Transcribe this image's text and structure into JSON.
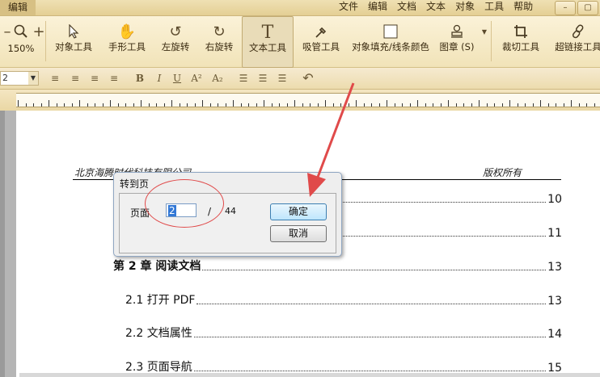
{
  "app_tab": "编辑",
  "menu": [
    "文件",
    "编辑",
    "文档",
    "文本",
    "对象",
    "工具",
    "帮助"
  ],
  "window": {
    "minimize": "–",
    "restore": "▢"
  },
  "toolbar": {
    "zoom_in": "+",
    "zoom_level": "150%",
    "tools": [
      {
        "label": "对象工具",
        "icon": "cursor-icon"
      },
      {
        "label": "手形工具",
        "icon": "hand-icon"
      },
      {
        "label": "左旋转",
        "icon": "rotate-left-icon"
      },
      {
        "label": "右旋转",
        "icon": "rotate-right-icon"
      },
      {
        "label": "文本工具",
        "icon": "text-tool-icon"
      },
      {
        "label": "吸管工具",
        "icon": "eyedropper-icon"
      },
      {
        "label": "对象填充/线条颜色",
        "icon": "fill-color-icon"
      },
      {
        "label": "图章 (S)",
        "icon": "stamp-icon"
      },
      {
        "label": "裁切工具",
        "icon": "crop-icon"
      },
      {
        "label": "超链接工具",
        "icon": "link-icon"
      }
    ]
  },
  "format": {
    "font_size": "2",
    "bold": "B",
    "italic": "I",
    "underline": "U",
    "superscript": "A²",
    "subscript": "A₂",
    "undo": "↶"
  },
  "document": {
    "header_left": "北京海腾时代科技有限公司",
    "header_right": "版权所有",
    "toc": [
      {
        "title": "",
        "page": "10"
      },
      {
        "title": "",
        "page": "11"
      },
      {
        "title": "第 2 章  阅读文档",
        "page": "13",
        "chapter": true
      },
      {
        "title": "2.1 打开 PDF",
        "page": "13"
      },
      {
        "title": "2.2 文档属性",
        "page": "14"
      },
      {
        "title": "2.3 页面导航",
        "page": "15"
      }
    ]
  },
  "dialog": {
    "title": "转到页",
    "page_label": "页面",
    "page_value": "2",
    "separator": "/",
    "total_pages": "44",
    "ok": "确定",
    "cancel": "取消"
  },
  "accent": {
    "annotation_red": "#e04a4a",
    "ribbon_bg": "#f1e3b8"
  }
}
